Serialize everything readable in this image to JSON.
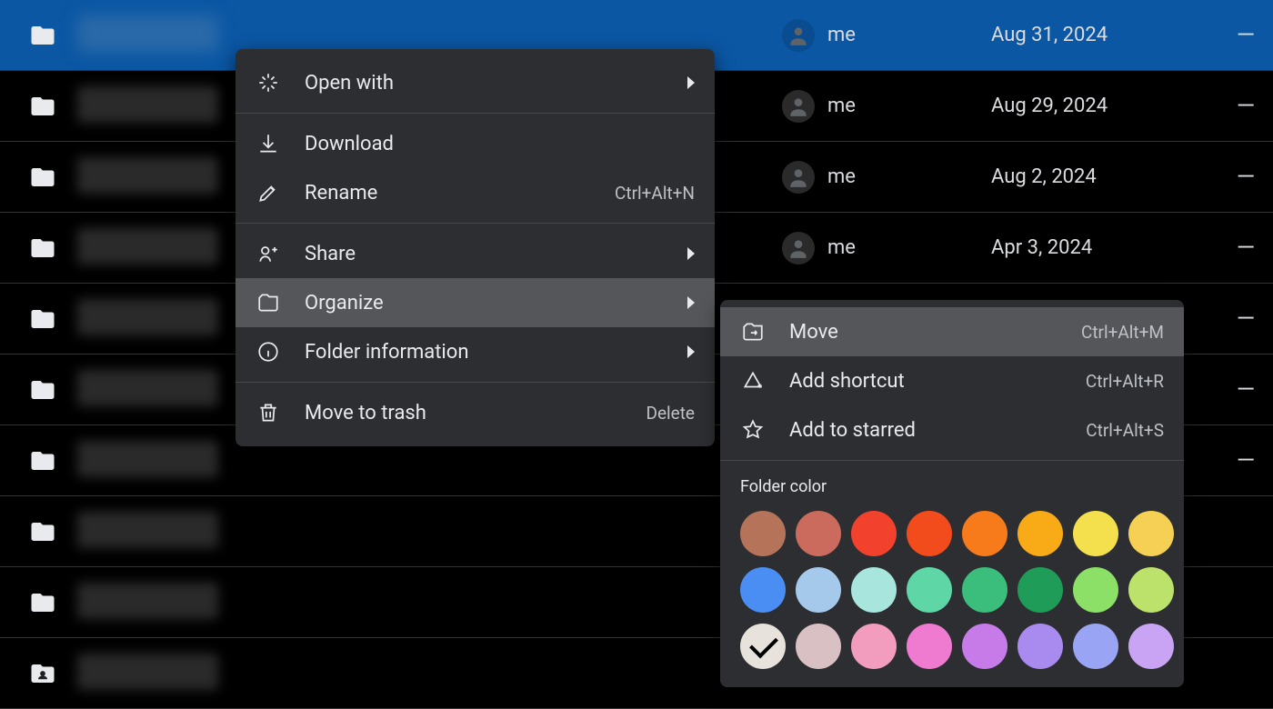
{
  "rows": [
    {
      "owner": "me",
      "date": "Aug 31, 2024",
      "dash": "—",
      "selected": true,
      "shared": false
    },
    {
      "owner": "me",
      "date": "Aug 29, 2024",
      "dash": "—",
      "selected": false,
      "shared": false
    },
    {
      "owner": "me",
      "date": "Aug 2, 2024",
      "dash": "—",
      "selected": false,
      "shared": false
    },
    {
      "owner": "me",
      "date": "Apr 3, 2024",
      "dash": "—",
      "selected": false,
      "shared": false
    },
    {
      "owner": "",
      "date": "",
      "dash": "—",
      "selected": false,
      "shared": false
    },
    {
      "owner": "",
      "date": "",
      "dash": "—",
      "selected": false,
      "shared": false
    },
    {
      "owner": "",
      "date": "",
      "dash": "—",
      "selected": false,
      "shared": false
    },
    {
      "owner": "",
      "date": "",
      "dash": "",
      "selected": false,
      "shared": false
    },
    {
      "owner": "",
      "date": "",
      "dash": "",
      "selected": false,
      "shared": false
    },
    {
      "owner": "",
      "date": "",
      "dash": "",
      "selected": false,
      "shared": true
    }
  ],
  "menu": {
    "open_with": {
      "label": "Open with"
    },
    "download": {
      "label": "Download"
    },
    "rename": {
      "label": "Rename",
      "shortcut": "Ctrl+Alt+N"
    },
    "share": {
      "label": "Share"
    },
    "organize": {
      "label": "Organize"
    },
    "folder_info": {
      "label": "Folder information"
    },
    "trash": {
      "label": "Move to trash",
      "shortcut": "Delete"
    }
  },
  "submenu": {
    "move": {
      "label": "Move",
      "shortcut": "Ctrl+Alt+M"
    },
    "shortcut": {
      "label": "Add shortcut",
      "shortcut": "Ctrl+Alt+R"
    },
    "starred": {
      "label": "Add to starred",
      "shortcut": "Ctrl+Alt+S"
    },
    "color_title": "Folder color",
    "colors": [
      "#b5745a",
      "#cb6b5e",
      "#f2422e",
      "#f24c1c",
      "#f77b1b",
      "#f9ab17",
      "#f4e04c",
      "#f6d054",
      "#4a8ef3",
      "#a5c9ea",
      "#a8e5dd",
      "#5fd6a6",
      "#3bbd7c",
      "#1f9c57",
      "#8de067",
      "#bde26c",
      "#e8e2dd",
      "#d9c0c3",
      "#f29cbe",
      "#ef7bd1",
      "#c77be8",
      "#a98bf0",
      "#9aa4f4",
      "#c9a4f4"
    ],
    "selected_color_index": 16
  }
}
